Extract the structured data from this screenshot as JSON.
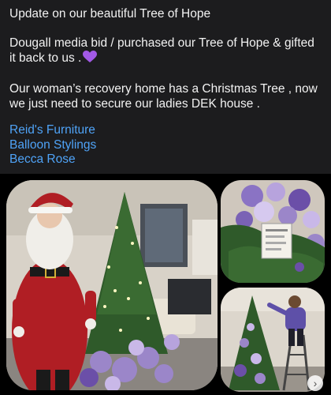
{
  "post": {
    "line1": "Update on our beautiful Tree of Hope",
    "line2": "Dougall media bid / purchased our Tree of Hope & gifted it back to us .",
    "heart_icon": "purple-heart-icon",
    "line3": "Our woman’s recovery home has a Christmas Tree , now we just need to secure our ladies DEK house ."
  },
  "tags": [
    "Reid's Furniture",
    "Balloon Stylings",
    "Becca Rose"
  ],
  "colors": {
    "background": "#1c1c1e",
    "link": "#4fa3f7",
    "text": "#f2f2f2",
    "heart": "#a259e6"
  },
  "photos": {
    "main": "santa-with-christmas-tree-photo",
    "top_right": "tree-with-sign-photo",
    "bottom_right": "woman-on-ladder-decorating-tree-photo",
    "next_icon": "chevron-right-icon"
  }
}
